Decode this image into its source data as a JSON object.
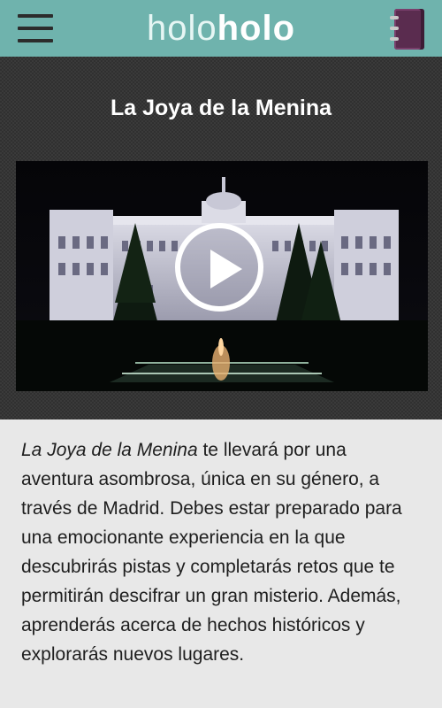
{
  "header": {
    "logo_light": "holo",
    "logo_bold": "holo",
    "menu_icon": "hamburger-menu-icon",
    "book_icon": "notebook-icon",
    "accent_color": "#6fb3ad"
  },
  "main": {
    "title": "La Joya de la Menina",
    "video": {
      "play_icon": "play-icon"
    },
    "description": {
      "title_ref": "La Joya de la Menina",
      "text": "  te llevará por una aventura asombrosa, única en su género, a través de Madrid. Debes estar preparado para una emocionante experiencia en la que descubrirás pistas y completarás retos que te permitirán descifrar un gran misterio. Además, aprenderás acerca de hechos históricos y explorarás nuevos lugares."
    }
  }
}
